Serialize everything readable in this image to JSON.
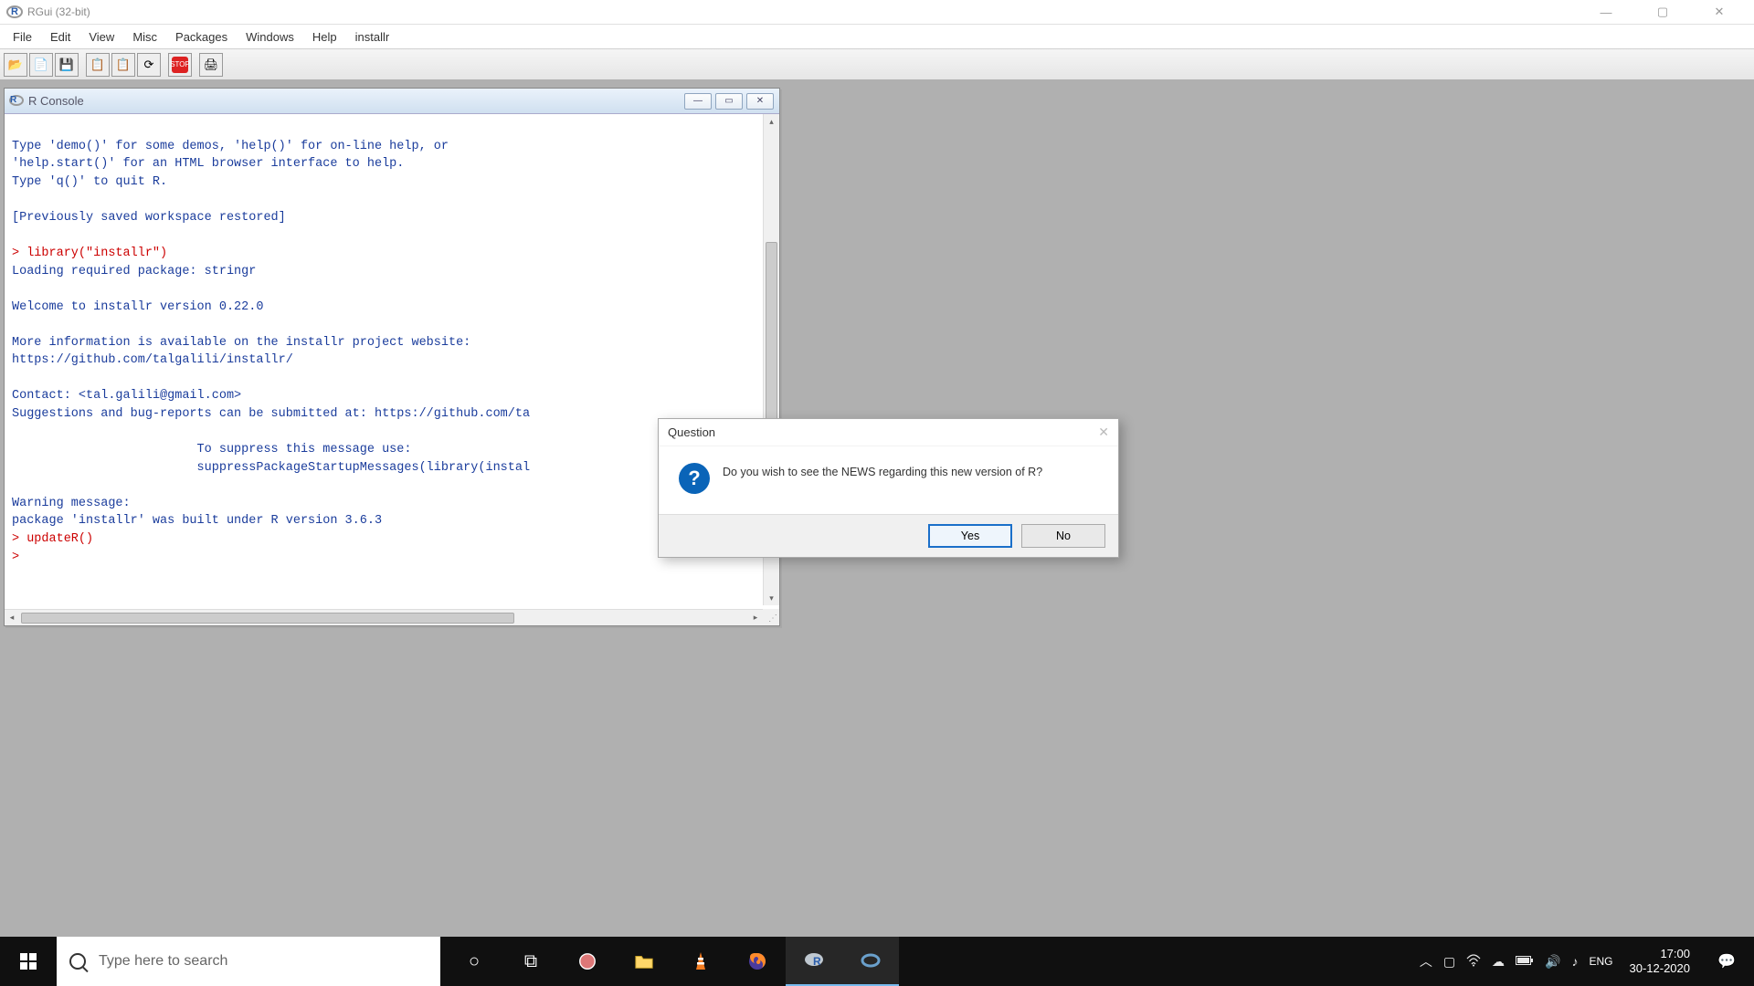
{
  "window": {
    "title": "RGui (32-bit)"
  },
  "menus": [
    "File",
    "Edit",
    "View",
    "Misc",
    "Packages",
    "Windows",
    "Help",
    "installr"
  ],
  "console": {
    "title": "R Console",
    "lines": [
      {
        "t": "blue",
        "txt": ""
      },
      {
        "t": "blue",
        "txt": "Type 'demo()' for some demos, 'help()' for on-line help, or"
      },
      {
        "t": "blue",
        "txt": "'help.start()' for an HTML browser interface to help."
      },
      {
        "t": "blue",
        "txt": "Type 'q()' to quit R."
      },
      {
        "t": "blue",
        "txt": ""
      },
      {
        "t": "blue",
        "txt": "[Previously saved workspace restored]"
      },
      {
        "t": "blue",
        "txt": ""
      },
      {
        "t": "red",
        "txt": "> library(\"installr\")"
      },
      {
        "t": "blue",
        "txt": "Loading required package: stringr"
      },
      {
        "t": "blue",
        "txt": ""
      },
      {
        "t": "blue",
        "txt": "Welcome to installr version 0.22.0"
      },
      {
        "t": "blue",
        "txt": ""
      },
      {
        "t": "blue",
        "txt": "More information is available on the installr project website:"
      },
      {
        "t": "blue",
        "txt": "https://github.com/talgalili/installr/"
      },
      {
        "t": "blue",
        "txt": ""
      },
      {
        "t": "blue",
        "txt": "Contact: <tal.galili@gmail.com>"
      },
      {
        "t": "blue",
        "txt": "Suggestions and bug-reports can be submitted at: https://github.com/ta"
      },
      {
        "t": "blue",
        "txt": ""
      },
      {
        "t": "blue",
        "txt": "                         To suppress this message use:"
      },
      {
        "t": "blue",
        "txt": "                         suppressPackageStartupMessages(library(instal"
      },
      {
        "t": "blue",
        "txt": ""
      },
      {
        "t": "blue",
        "txt": "Warning message:"
      },
      {
        "t": "blue",
        "txt": "package 'installr' was built under R version 3.6.3 "
      },
      {
        "t": "red",
        "txt": "> updateR()"
      },
      {
        "t": "red",
        "txt": "> "
      }
    ]
  },
  "dialog": {
    "title": "Question",
    "message": "Do you wish to see the NEWS regarding this new version of R?",
    "yes": "Yes",
    "no": "No"
  },
  "taskbar": {
    "search_placeholder": "Type here to search",
    "lang": "ENG",
    "time": "17:00",
    "date": "30-12-2020"
  },
  "toolbar_icons": {
    "open": "📂",
    "source": "📄",
    "save": "💾",
    "copy": "📋",
    "paste": "📋",
    "refresh": "⟳",
    "stop": "STOP",
    "print": "🖨"
  }
}
